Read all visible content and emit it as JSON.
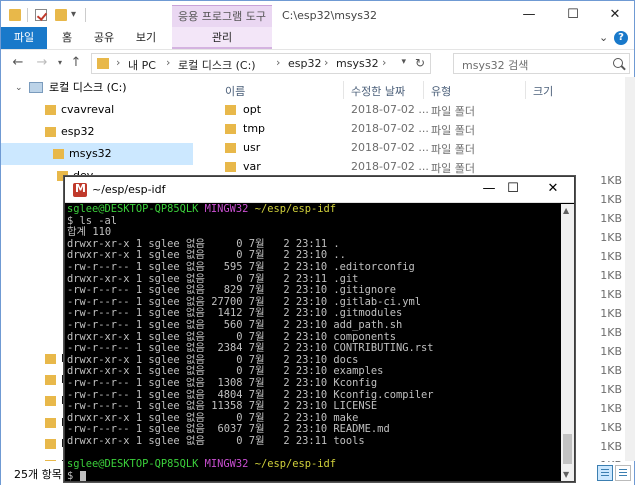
{
  "explorer": {
    "title_path": "C:\\esp32\\msys32",
    "context_tab": "응용 프로그램 도구",
    "ribbon_tabs": [
      "파일",
      "홈",
      "공유",
      "보기",
      "관리"
    ],
    "address": {
      "crumbs": [
        "내 PC",
        "로컬 디스크 (C:)",
        "esp32",
        "msys32"
      ],
      "search_placeholder": "msys32 검색"
    },
    "nav": [
      {
        "label": "로컬 디스크 (C:)",
        "type": "drive"
      },
      {
        "label": "cvavreval",
        "type": "folder"
      },
      {
        "label": "esp32",
        "type": "folder"
      },
      {
        "label": "msys32",
        "type": "folder",
        "selected": true
      },
      {
        "label": "dev",
        "type": "folder"
      },
      {
        "label": "Ke",
        "type": "folder"
      },
      {
        "label": "PE",
        "type": "folder"
      },
      {
        "label": "Pe",
        "type": "folder"
      },
      {
        "label": "Pr",
        "type": "folder"
      },
      {
        "label": "Pr",
        "type": "folder"
      },
      {
        "label": "Pr",
        "type": "folder"
      }
    ],
    "columns": [
      "이름",
      "수정한 날짜",
      "유형",
      "크기"
    ],
    "files": [
      {
        "name": "opt",
        "date": "2018-07-02 ...",
        "type": "파일 폴더",
        "size": ""
      },
      {
        "name": "tmp",
        "date": "2018-07-02 ...",
        "type": "파일 폴더",
        "size": ""
      },
      {
        "name": "usr",
        "date": "2018-07-02 ...",
        "type": "파일 폴더",
        "size": ""
      },
      {
        "name": "var",
        "date": "2018-07-02 ...",
        "type": "파일 폴더",
        "size": ""
      }
    ],
    "right_sizes": [
      "1KB",
      "1KB",
      "1KB",
      "1KB",
      "1KB",
      "1KB",
      "1KB",
      "1KB",
      "1KB",
      "1KB",
      "1KB",
      "1KB",
      "1KB",
      "1KB",
      "1KB",
      "1KB",
      "1KB"
    ],
    "status_count": "25개 항목"
  },
  "terminal": {
    "title": "~/esp/esp-idf",
    "prompt": {
      "user": "sglee@DESKTOP-QP85QLK",
      "system": "MINGW32",
      "path": "~/esp/esp-idf"
    },
    "command": "$ ls -al",
    "total": "합계 110",
    "entries": [
      {
        "perm": "drwxr-xr-x",
        "links": "1",
        "owner": "sglee",
        "group": "없음",
        "size": "0",
        "month": "7월",
        "day": "2",
        "time": "23:11",
        "name": "."
      },
      {
        "perm": "drwxr-xr-x",
        "links": "1",
        "owner": "sglee",
        "group": "없음",
        "size": "0",
        "month": "7월",
        "day": "2",
        "time": "23:10",
        "name": ".."
      },
      {
        "perm": "-rw-r--r--",
        "links": "1",
        "owner": "sglee",
        "group": "없음",
        "size": "595",
        "month": "7월",
        "day": "2",
        "time": "23:10",
        "name": ".editorconfig"
      },
      {
        "perm": "drwxr-xr-x",
        "links": "1",
        "owner": "sglee",
        "group": "없음",
        "size": "0",
        "month": "7월",
        "day": "2",
        "time": "23:11",
        "name": ".git"
      },
      {
        "perm": "-rw-r--r--",
        "links": "1",
        "owner": "sglee",
        "group": "없음",
        "size": "829",
        "month": "7월",
        "day": "2",
        "time": "23:10",
        "name": ".gitignore"
      },
      {
        "perm": "-rw-r--r--",
        "links": "1",
        "owner": "sglee",
        "group": "없음",
        "size": "27700",
        "month": "7월",
        "day": "2",
        "time": "23:10",
        "name": ".gitlab-ci.yml"
      },
      {
        "perm": "-rw-r--r--",
        "links": "1",
        "owner": "sglee",
        "group": "없음",
        "size": "1412",
        "month": "7월",
        "day": "2",
        "time": "23:10",
        "name": ".gitmodules"
      },
      {
        "perm": "-rw-r--r--",
        "links": "1",
        "owner": "sglee",
        "group": "없음",
        "size": "560",
        "month": "7월",
        "day": "2",
        "time": "23:10",
        "name": "add_path.sh"
      },
      {
        "perm": "drwxr-xr-x",
        "links": "1",
        "owner": "sglee",
        "group": "없음",
        "size": "0",
        "month": "7월",
        "day": "2",
        "time": "23:10",
        "name": "components"
      },
      {
        "perm": "-rw-r--r--",
        "links": "1",
        "owner": "sglee",
        "group": "없음",
        "size": "2384",
        "month": "7월",
        "day": "2",
        "time": "23:10",
        "name": "CONTRIBUTING.rst"
      },
      {
        "perm": "drwxr-xr-x",
        "links": "1",
        "owner": "sglee",
        "group": "없음",
        "size": "0",
        "month": "7월",
        "day": "2",
        "time": "23:10",
        "name": "docs"
      },
      {
        "perm": "drwxr-xr-x",
        "links": "1",
        "owner": "sglee",
        "group": "없음",
        "size": "0",
        "month": "7월",
        "day": "2",
        "time": "23:10",
        "name": "examples"
      },
      {
        "perm": "-rw-r--r--",
        "links": "1",
        "owner": "sglee",
        "group": "없음",
        "size": "1308",
        "month": "7월",
        "day": "2",
        "time": "23:10",
        "name": "Kconfig"
      },
      {
        "perm": "-rw-r--r--",
        "links": "1",
        "owner": "sglee",
        "group": "없음",
        "size": "4804",
        "month": "7월",
        "day": "2",
        "time": "23:10",
        "name": "Kconfig.compiler"
      },
      {
        "perm": "-rw-r--r--",
        "links": "1",
        "owner": "sglee",
        "group": "없음",
        "size": "11358",
        "month": "7월",
        "day": "2",
        "time": "23:10",
        "name": "LICENSE"
      },
      {
        "perm": "drwxr-xr-x",
        "links": "1",
        "owner": "sglee",
        "group": "없음",
        "size": "0",
        "month": "7월",
        "day": "2",
        "time": "23:10",
        "name": "make"
      },
      {
        "perm": "-rw-r--r--",
        "links": "1",
        "owner": "sglee",
        "group": "없음",
        "size": "6037",
        "month": "7월",
        "day": "2",
        "time": "23:10",
        "name": "README.md"
      },
      {
        "perm": "drwxr-xr-x",
        "links": "1",
        "owner": "sglee",
        "group": "없음",
        "size": "0",
        "month": "7월",
        "day": "2",
        "time": "23:11",
        "name": "tools"
      }
    ],
    "input_prompt": "$ "
  }
}
